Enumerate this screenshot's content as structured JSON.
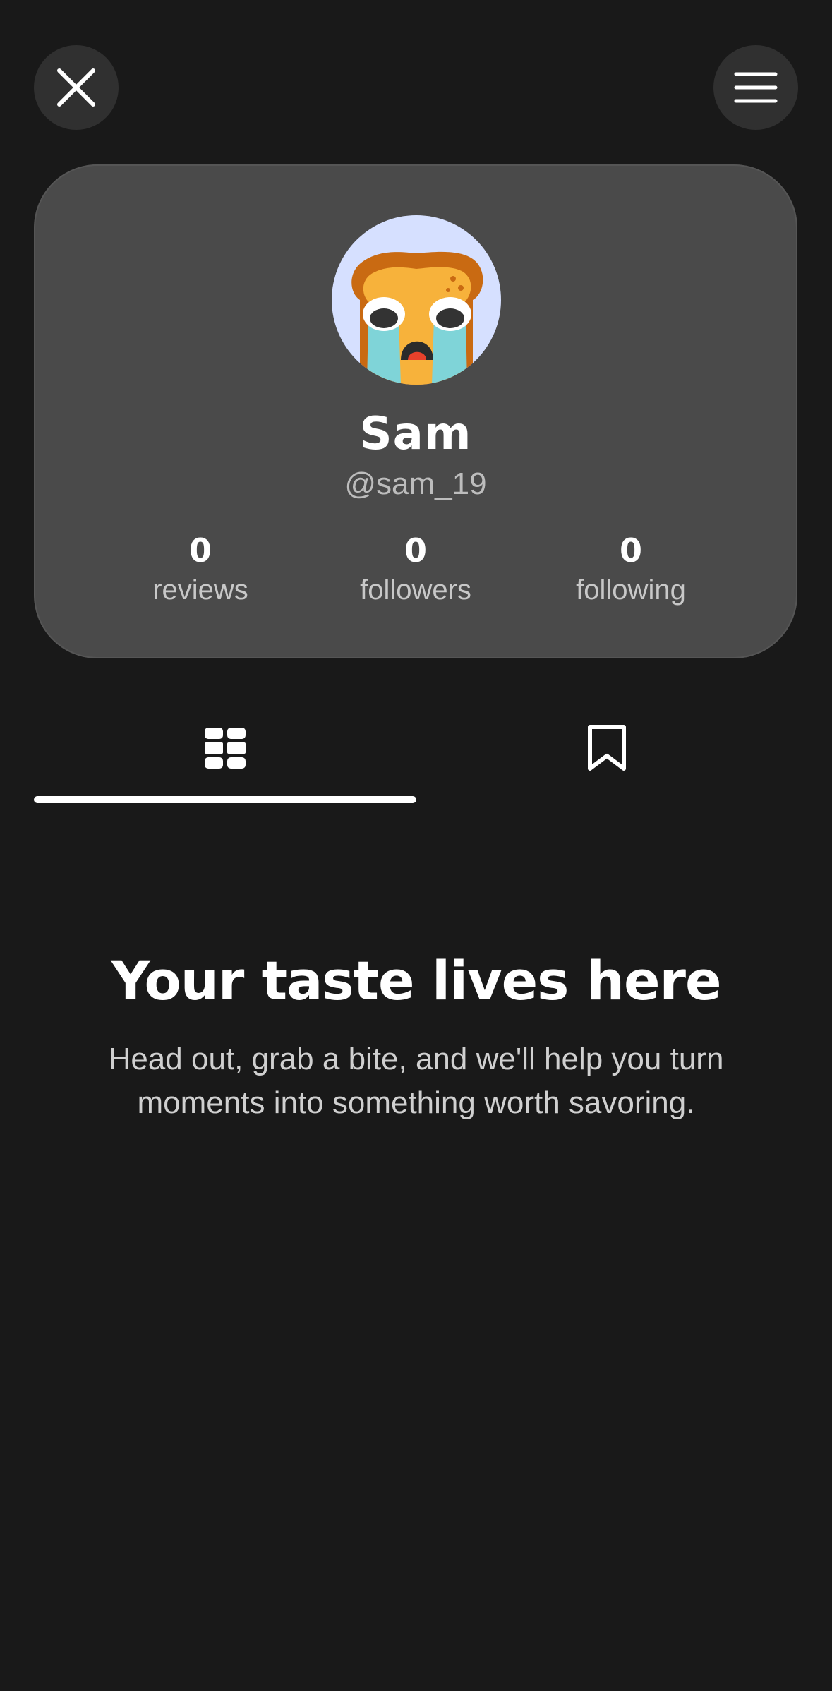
{
  "header": {
    "close_icon": "close-icon",
    "menu_icon": "hamburger-menu-icon"
  },
  "profile": {
    "name": "Sam",
    "handle": "@sam_19",
    "avatar_icon": "crying-toast-avatar",
    "stats": [
      {
        "value": "0",
        "label": "reviews"
      },
      {
        "value": "0",
        "label": "followers"
      },
      {
        "value": "0",
        "label": "following"
      }
    ]
  },
  "tabs": [
    {
      "icon": "grid-icon",
      "selected": true
    },
    {
      "icon": "bookmark-icon",
      "selected": false
    }
  ],
  "empty_state": {
    "title": "Your taste lives here",
    "body": "Head out, grab a bite, and we'll help you turn moments into something worth savoring."
  },
  "colors": {
    "background": "#191919",
    "card": "#4a4a4a",
    "button": "#303030",
    "avatar_bg": "#d6e0ff"
  }
}
